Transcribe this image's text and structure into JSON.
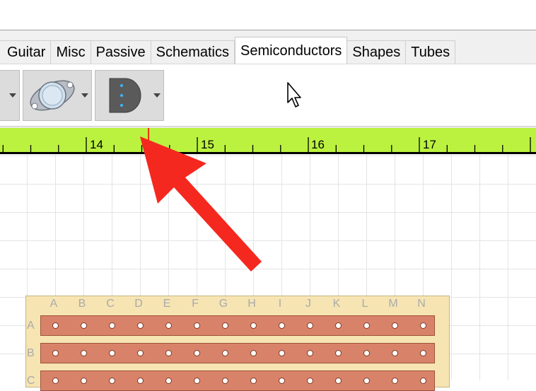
{
  "tabs": [
    {
      "label": "Guitar",
      "active": false
    },
    {
      "label": "Misc",
      "active": false
    },
    {
      "label": "Passive",
      "active": false
    },
    {
      "label": "Schematics",
      "active": false
    },
    {
      "label": "Semiconductors",
      "active": true
    },
    {
      "label": "Shapes",
      "active": false
    },
    {
      "label": "Tubes",
      "active": false
    }
  ],
  "toolbar": {
    "tools": [
      {
        "icon": "component-icon",
        "has_dropdown": true
      },
      {
        "icon": "to3-transistor-icon",
        "has_dropdown": true
      },
      {
        "icon": "to92-transistor-icon",
        "has_dropdown": true
      }
    ]
  },
  "ruler": {
    "color": "#bbf23f",
    "labels": [
      "14",
      "15",
      "16",
      "17"
    ],
    "cursor_marker_color": "#ff0000"
  },
  "annotation": {
    "arrow_color": "#f5281f",
    "points_to": "ruler-cursor-marker"
  },
  "board": {
    "columns": [
      "A",
      "B",
      "C",
      "D",
      "E",
      "F",
      "G",
      "H",
      "I",
      "J",
      "K",
      "L",
      "M",
      "N"
    ],
    "rows": [
      "A",
      "B",
      "C"
    ],
    "strip_color": "#d9826a",
    "board_color": "#f6e4b3"
  }
}
